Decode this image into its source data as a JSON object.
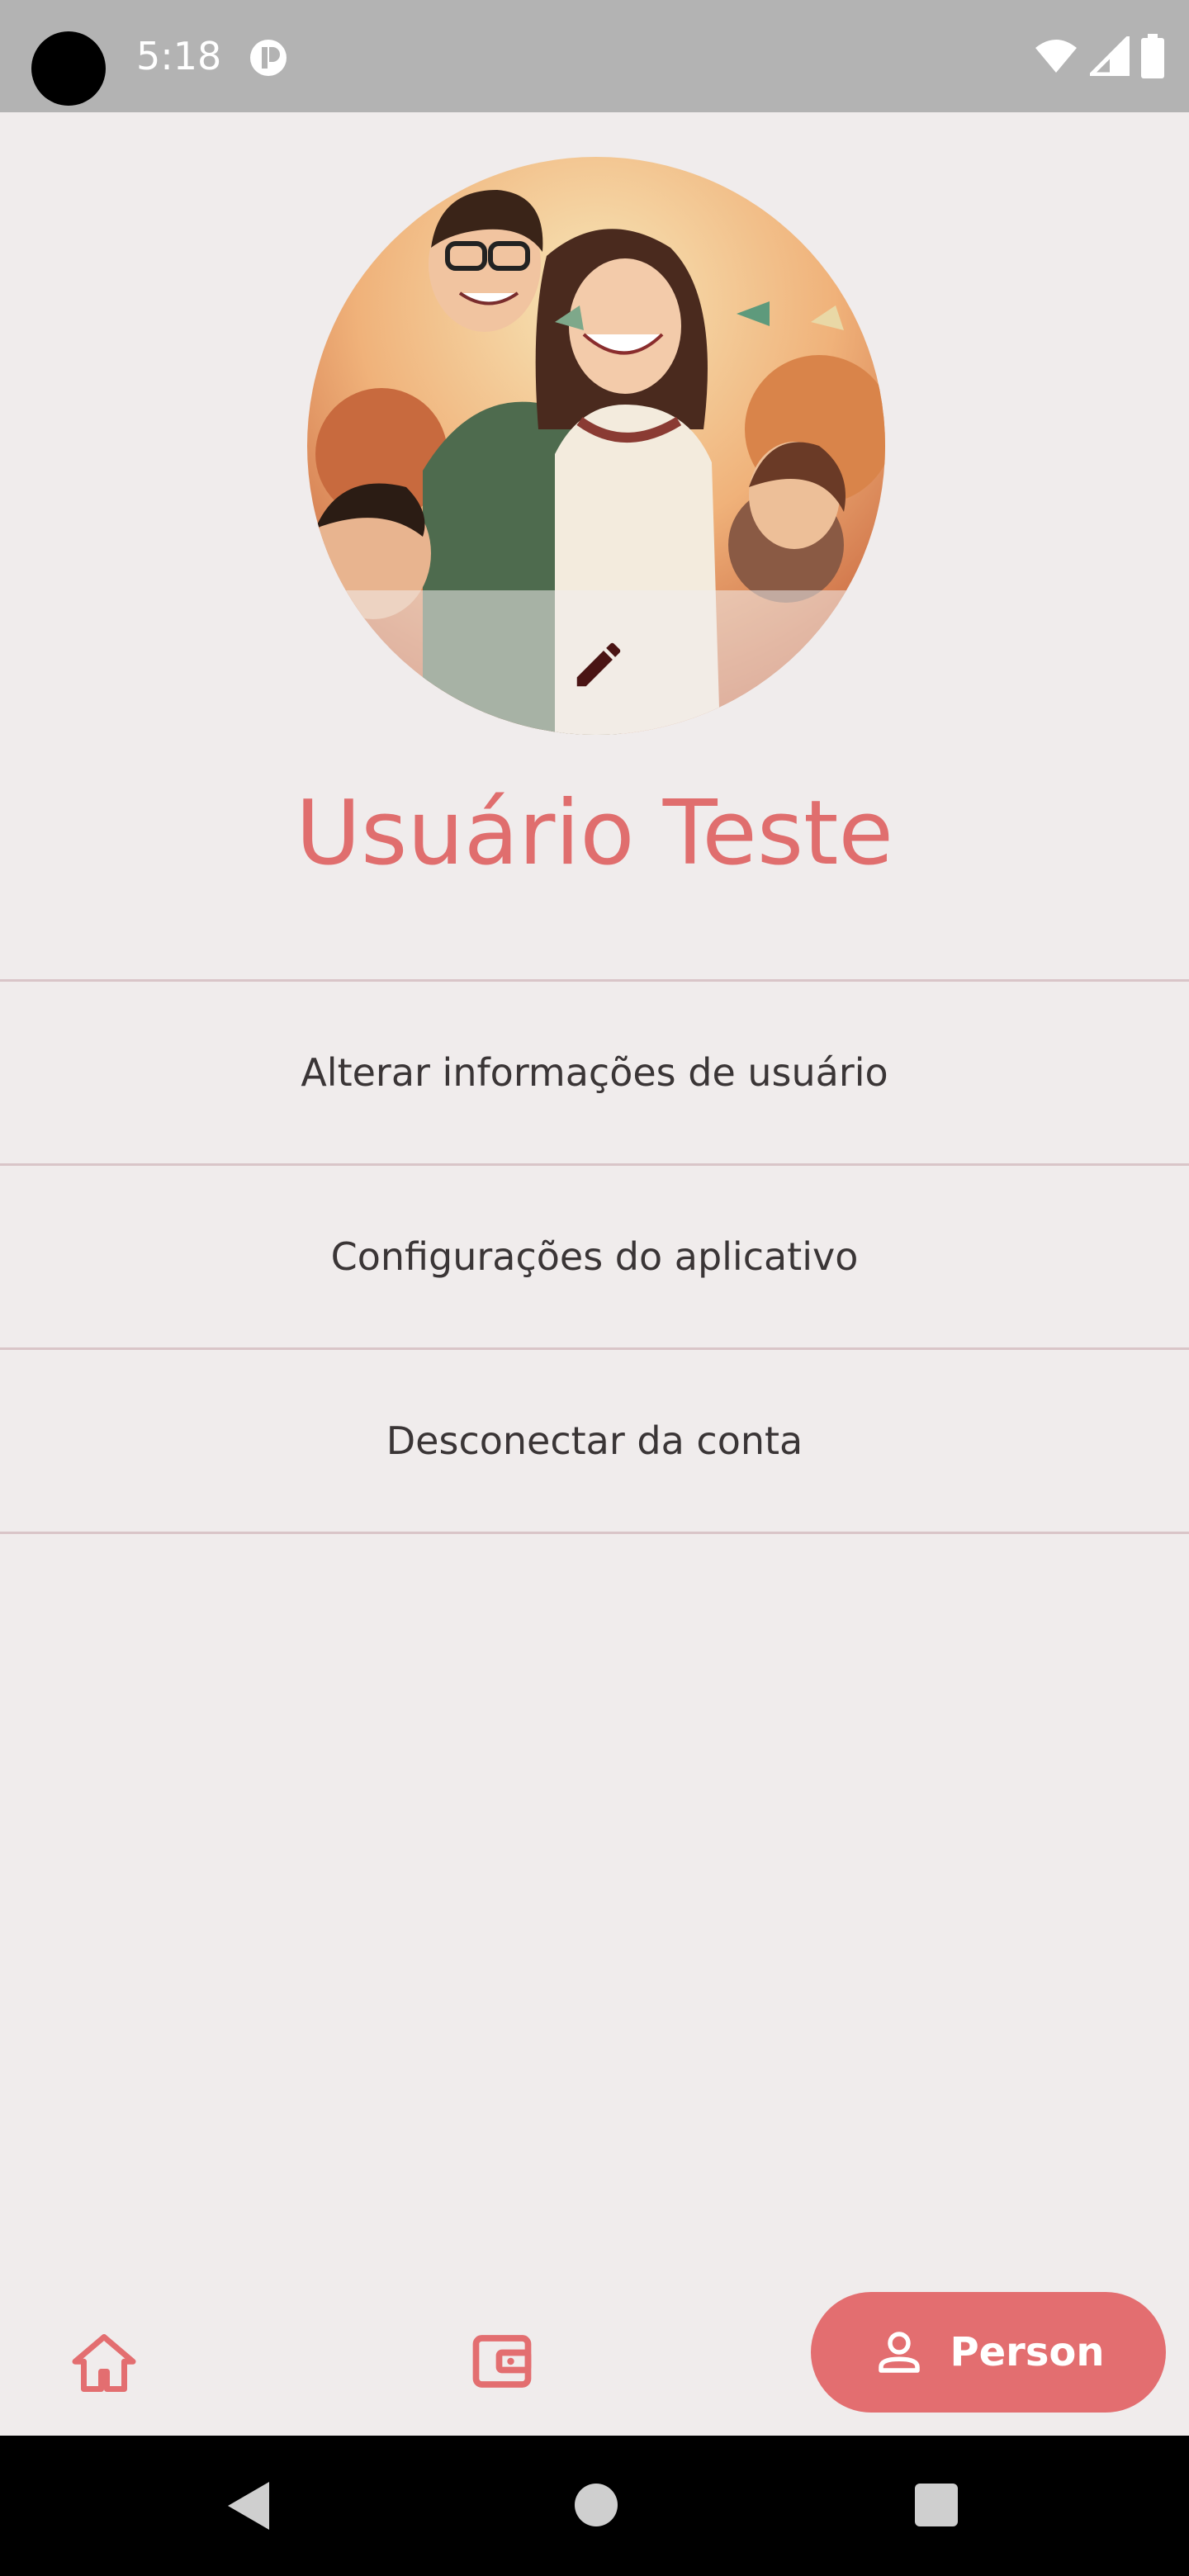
{
  "status_bar": {
    "time": "5:18"
  },
  "profile": {
    "user_name": "Usuário Teste"
  },
  "menu": {
    "items": [
      {
        "label": "Alterar informações de usuário"
      },
      {
        "label": "Configurações do aplicativo"
      },
      {
        "label": "Desconectar da conta"
      }
    ]
  },
  "bottom_nav": {
    "home_icon": "home-icon",
    "wallet_icon": "wallet-icon",
    "person_icon": "person-icon",
    "person_label": "Person"
  },
  "colors": {
    "accent": "#E36E70",
    "name_color": "#E06E6E",
    "background": "#F0ECEC",
    "divider": "#D9C5C8"
  }
}
